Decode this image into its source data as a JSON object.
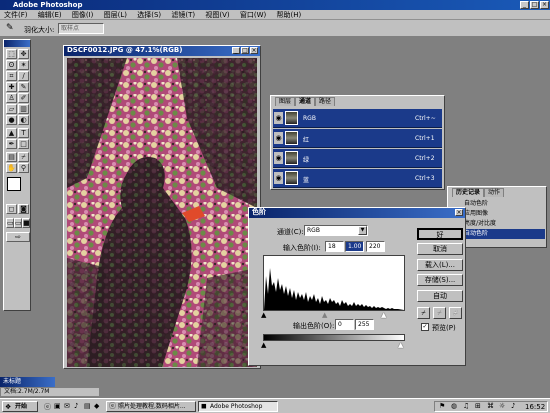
{
  "app": {
    "title": "Adobe Photoshop"
  },
  "menu": [
    "文件(F)",
    "编辑(E)",
    "图像(I)",
    "图层(L)",
    "选择(S)",
    "滤镜(T)",
    "视图(V)",
    "窗口(W)",
    "帮助(H)"
  ],
  "options": {
    "label": "羽化大小:",
    "value": "取样点"
  },
  "document": {
    "title": "DSCF0012.JPG @ 47.1%(RGB)"
  },
  "channels": {
    "tabs": [
      "图层",
      "通道",
      "路径"
    ],
    "rows": [
      {
        "name": "RGB",
        "shortcut": "Ctrl+~"
      },
      {
        "name": "红",
        "shortcut": "Ctrl+1"
      },
      {
        "name": "绿",
        "shortcut": "Ctrl+2"
      },
      {
        "name": "蓝",
        "shortcut": "Ctrl+3"
      }
    ]
  },
  "history": {
    "tabs": [
      "历史记录",
      "动作"
    ],
    "items": [
      "自动色阶",
      "应用图像",
      "亮度/对比度",
      "自动色阶"
    ]
  },
  "levels": {
    "title": "色阶",
    "channel_label": "通道(C):",
    "channel_value": "RGB",
    "input_label": "输入色阶(I):",
    "input_values": [
      "18",
      "1.00",
      "220"
    ],
    "output_label": "输出色阶(O):",
    "output_values": [
      "0",
      "255"
    ],
    "buttons": {
      "ok": "好",
      "cancel": "取消",
      "load": "载入(L)...",
      "save": "存储(S)...",
      "auto": "自动"
    },
    "preview_label": "预览(P)"
  },
  "status": {
    "doc": "文档:2.7M/2.7M",
    "minimized": "未标题"
  },
  "taskbar": {
    "start": "开始",
    "tasks": [
      "照片处理教程,数码相片...",
      "Adobe Photoshop"
    ],
    "clock": "16:52"
  }
}
